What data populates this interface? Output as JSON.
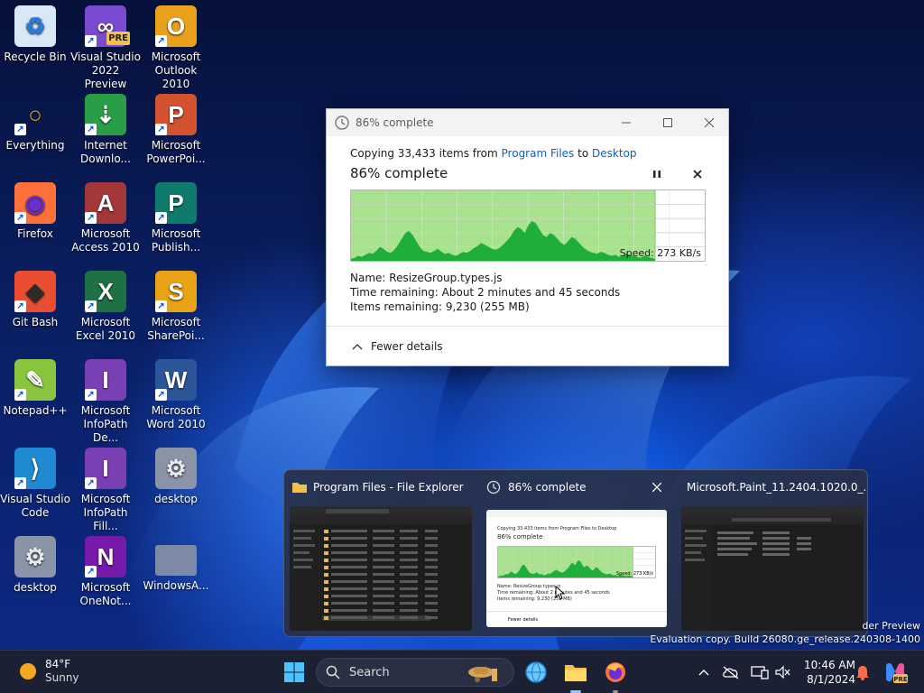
{
  "desktop": {
    "icons": [
      {
        "label": "Recycle Bin",
        "icon": "recycle-bin-icon"
      },
      {
        "label": "Visual Studio 2022 Preview",
        "icon": "visual-studio-preview-icon",
        "badge": "PRE"
      },
      {
        "label": "Microsoft Outlook 2010",
        "icon": "outlook-icon"
      },
      {
        "label": "Everything",
        "icon": "everything-search-icon"
      },
      {
        "label": "Internet Downlo...",
        "icon": "internet-download-manager-icon"
      },
      {
        "label": "Microsoft PowerPoi...",
        "icon": "powerpoint-icon"
      },
      {
        "label": "Firefox",
        "icon": "firefox-icon"
      },
      {
        "label": "Microsoft Access 2010",
        "icon": "access-icon"
      },
      {
        "label": "Microsoft Publish...",
        "icon": "publisher-icon"
      },
      {
        "label": "Git Bash",
        "icon": "git-bash-icon"
      },
      {
        "label": "Microsoft Excel 2010",
        "icon": "excel-icon"
      },
      {
        "label": "Microsoft SharePoi...",
        "icon": "sharepoint-icon"
      },
      {
        "label": "Notepad++",
        "icon": "notepad-plus-plus-icon"
      },
      {
        "label": "Microsoft InfoPath De...",
        "icon": "infopath-designer-icon"
      },
      {
        "label": "Microsoft Word 2010",
        "icon": "word-icon"
      },
      {
        "label": "Visual Studio Code",
        "icon": "vscode-icon"
      },
      {
        "label": "Microsoft InfoPath Fill...",
        "icon": "infopath-filler-icon"
      },
      {
        "label": "desktop",
        "icon": "desktop-ini-file-icon"
      },
      {
        "label": "desktop",
        "icon": "desktop-ini-file-icon"
      },
      {
        "label": "Microsoft OneNot...",
        "icon": "onenote-icon"
      },
      {
        "label": "WindowsA...",
        "icon": "folder-icon"
      }
    ]
  },
  "copy_dialog": {
    "title": "86% complete",
    "line_prefix": "Copying 33,433 items from ",
    "source": "Program Files",
    "to_word": " to ",
    "destination": "Desktop",
    "percent_text": "86% complete",
    "progress": 0.86,
    "speed": "Speed: 273 KB/s",
    "name_label": "Name:",
    "name_value": "ResizeGroup.types.js",
    "time_label": "Time remaining:",
    "time_value": "About 2 minutes and 45 seconds",
    "items_label": "Items remaining:",
    "items_value": "9,230 (255 MB)",
    "fewer_details": "Fewer details"
  },
  "previews": [
    {
      "title": "Program Files - File Explorer",
      "icon": "folder-icon"
    },
    {
      "title": "86% complete",
      "icon": "clock-icon"
    },
    {
      "title": "Microsoft.Paint_11.2404.1020.0_...",
      "icon": "folder-icon"
    }
  ],
  "mini_dialog": {
    "line": "Copying 33,433 items from Program Files to Desktop",
    "percent": "86% complete",
    "speed": "Speed: 273 KB/s",
    "name": "Name: ResizeGroup.types.js",
    "time": "Time remaining: About 2 minutes and 45 seconds",
    "items": "Items remaining: 9,230 (255 MB)",
    "fewer": "Fewer details"
  },
  "watermark": {
    "line1": "der Preview",
    "line2": "Evaluation copy. Build 26080.ge_release.240308-1400"
  },
  "taskbar": {
    "temperature": "84°F",
    "condition": "Sunny",
    "search_placeholder": "Search",
    "time": "10:46 AM",
    "date": "8/1/2024"
  },
  "colors": {
    "accent": "#0a62c7",
    "graph_fill": "#a8e28e",
    "graph_peak": "#1fae3a",
    "taskbar": "#1c2033"
  }
}
